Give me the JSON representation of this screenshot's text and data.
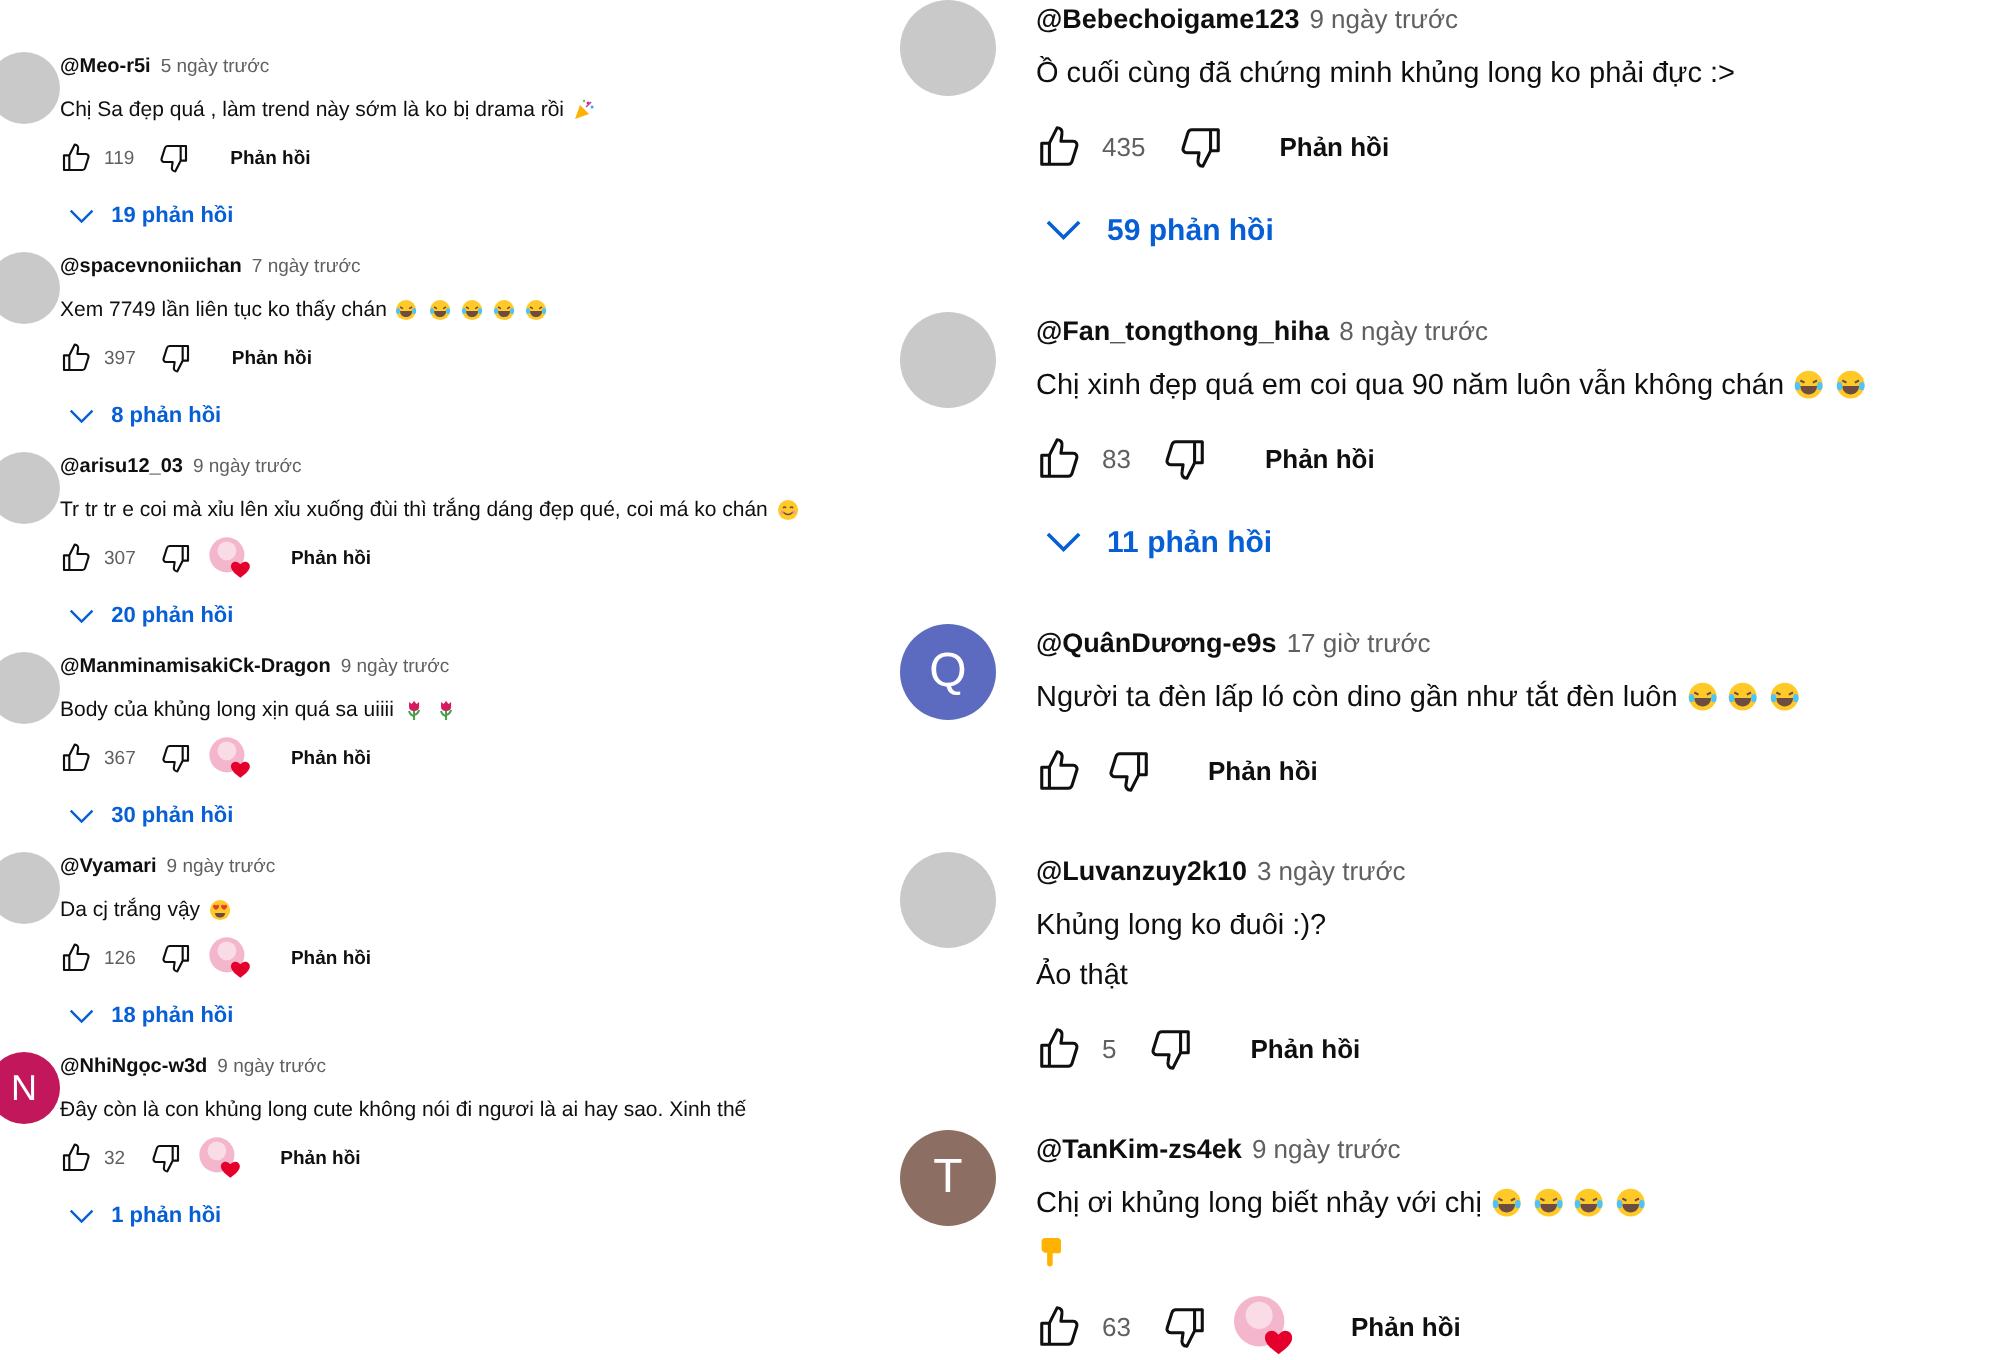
{
  "columns": [
    {
      "kind": "compact",
      "comments": [
        {
          "author": "@Meo-r5i",
          "time": "5 ngày trước",
          "avatar": {
            "kind": "image"
          },
          "lines": [
            {
              "text": "Chị Sa đẹp quá , làm trend này sớm là ko bị drama rồi",
              "emoji": [
                {
                  "kind": "party"
                }
              ]
            }
          ],
          "likes": "119",
          "creator_heart": false,
          "reply_label": "Phản hồi",
          "replies": "19 phản hồi"
        },
        {
          "author": "@spacevnoniichan",
          "time": "7 ngày trước",
          "avatar": {
            "kind": "image"
          },
          "lines": [
            {
              "text": "Xem 7749 lần liên tục ko thấy chán",
              "emoji": [
                {
                  "kind": "laugh"
                },
                {
                  "kind": "laugh"
                },
                {
                  "kind": "laugh"
                },
                {
                  "kind": "laugh"
                },
                {
                  "kind": "laugh"
                }
              ]
            }
          ],
          "likes": "397",
          "creator_heart": false,
          "reply_label": "Phản hồi",
          "replies": "8 phản hồi"
        },
        {
          "author": "@arisu12_03",
          "time": "9 ngày trước",
          "avatar": {
            "kind": "image"
          },
          "lines": [
            {
              "text": "Tr tr tr e coi mà xỉu lên xỉu xuống đùi thì trắng dáng đẹp qué, coi má ko chán",
              "emoji": [
                {
                  "kind": "smile"
                }
              ]
            }
          ],
          "likes": "307",
          "creator_heart": true,
          "reply_label": "Phản hồi",
          "replies": "20 phản hồi"
        },
        {
          "author": "@ManminamisakiCk-Dragon",
          "time": "9 ngày trước",
          "avatar": {
            "kind": "image"
          },
          "lines": [
            {
              "text": "Body của khủng long xịn quá sa uiiii",
              "emoji": [
                {
                  "kind": "tulip"
                },
                {
                  "kind": "tulip"
                }
              ]
            }
          ],
          "likes": "367",
          "creator_heart": true,
          "reply_label": "Phản hồi",
          "replies": "30 phản hồi"
        },
        {
          "author": "@Vyamari",
          "time": "9 ngày trước",
          "avatar": {
            "kind": "image"
          },
          "lines": [
            {
              "text": "Da cj trắng vậy",
              "emoji": [
                {
                  "kind": "heart-eyes"
                }
              ]
            }
          ],
          "likes": "126",
          "creator_heart": true,
          "reply_label": "Phản hồi",
          "replies": "18 phản hồi"
        },
        {
          "author": "@NhiNgọc-w3d",
          "time": "9 ngày trước",
          "avatar": {
            "kind": "letter",
            "letter": "N",
            "color": "#c2185b"
          },
          "lines": [
            {
              "text": "Đây còn là con khủng long cute không nói đi ngươi là ai hay sao. Xinh thế"
            }
          ],
          "likes": "32",
          "creator_heart": true,
          "reply_label": "Phản hồi",
          "replies": "1 phản hồi"
        }
      ]
    },
    {
      "kind": "regular",
      "comments": [
        {
          "author": "@Bebechoigame123",
          "time": "9 ngày trước",
          "avatar": {
            "kind": "image"
          },
          "lines": [
            {
              "text": "Ồ cuối cùng đã chứng minh khủng long ko phải đực :>"
            }
          ],
          "likes": "435",
          "creator_heart": false,
          "reply_label": "Phản hồi",
          "replies": "59 phản hồi"
        },
        {
          "author": "@Fan_tongthong_hiha",
          "time": "8 ngày trước",
          "avatar": {
            "kind": "image"
          },
          "lines": [
            {
              "text": "Chị xinh đẹp quá em coi qua 90 năm luôn vẫn không chán",
              "emoji": [
                {
                  "kind": "laugh"
                },
                {
                  "kind": "laugh"
                }
              ]
            }
          ],
          "likes": "83",
          "creator_heart": false,
          "reply_label": "Phản hồi",
          "replies": "11 phản hồi"
        },
        {
          "author": "@QuânDương-e9s",
          "time": "17 giờ trước",
          "avatar": {
            "kind": "letter",
            "letter": "Q",
            "color": "#5c6bc0"
          },
          "lines": [
            {
              "text": "Người ta đèn lấp ló còn dino gần như tắt đèn luôn",
              "emoji": [
                {
                  "kind": "laugh"
                },
                {
                  "kind": "laugh"
                },
                {
                  "kind": "laugh"
                }
              ]
            }
          ],
          "creator_heart": false,
          "reply_label": "Phản hồi"
        },
        {
          "author": "@Luvanzuy2k10",
          "time": "3 ngày trước",
          "avatar": {
            "kind": "image"
          },
          "lines": [
            {
              "text": "Khủng long ko đuôi :)?"
            },
            {
              "text": "Ảo thật"
            }
          ],
          "likes": "5",
          "creator_heart": false,
          "reply_label": "Phản hồi"
        },
        {
          "author": "@TanKim-zs4ek",
          "time": "9 ngày trước",
          "avatar": {
            "kind": "letter",
            "letter": "T",
            "color": "#8d6e63"
          },
          "lines": [
            {
              "text": "Chị ơi khủng long biết nhảy với chị",
              "emoji": [
                {
                  "kind": "laugh"
                },
                {
                  "kind": "laugh"
                },
                {
                  "kind": "laugh"
                },
                {
                  "kind": "laugh"
                }
              ]
            },
            {
              "emoji": [
                {
                  "kind": "point-down"
                }
              ]
            }
          ],
          "likes": "63",
          "creator_heart": true,
          "reply_label": "Phản hồi"
        }
      ]
    }
  ]
}
